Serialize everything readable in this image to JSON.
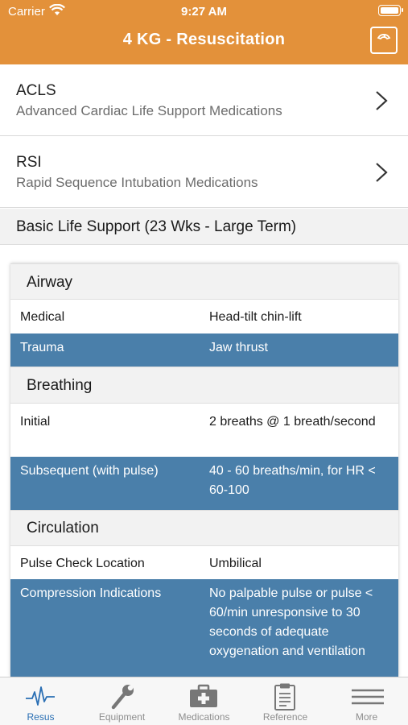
{
  "status_bar": {
    "carrier": "Carrier",
    "time": "9:27 AM"
  },
  "nav": {
    "title": "4 KG - Resuscitation",
    "scale_icon": "scale-icon"
  },
  "menu": [
    {
      "title": "ACLS",
      "subtitle": "Advanced Cardiac Life Support Medications"
    },
    {
      "title": "RSI",
      "subtitle": "Rapid Sequence Intubation Medications"
    }
  ],
  "section": {
    "title": "Basic Life Support (23 Wks - Large Term)"
  },
  "groups": {
    "airway": {
      "title": "Airway",
      "rows": [
        {
          "label": "Medical",
          "value": "Head-tilt chin-lift"
        },
        {
          "label": "Trauma",
          "value": "Jaw thrust"
        }
      ]
    },
    "breathing": {
      "title": "Breathing",
      "rows": [
        {
          "label": "Initial",
          "value": "2 breaths @ 1 breath/second"
        },
        {
          "label": "Subsequent (with pulse)",
          "value": "40 - 60 breaths/min, for HR < 60-100"
        }
      ]
    },
    "circulation": {
      "title": "Circulation",
      "rows": [
        {
          "label": "Pulse Check Location",
          "value": "Umbilical"
        },
        {
          "label": "Compression Indications",
          "value": "No palpable pulse or pulse < 60/min unresponsive to 30 seconds of adequate oxygenation and ventilation"
        }
      ]
    }
  },
  "colors": {
    "header": "#e3913a",
    "highlight_row": "#4a7faa",
    "active_tab": "#2a6fb4"
  },
  "tabs": [
    {
      "label": "Resus",
      "icon": "heartbeat-icon",
      "active": true
    },
    {
      "label": "Equipment",
      "icon": "wrench-icon",
      "active": false
    },
    {
      "label": "Medications",
      "icon": "medkit-icon",
      "active": false
    },
    {
      "label": "Reference",
      "icon": "clipboard-icon",
      "active": false
    },
    {
      "label": "More",
      "icon": "menu-icon",
      "active": false
    }
  ]
}
